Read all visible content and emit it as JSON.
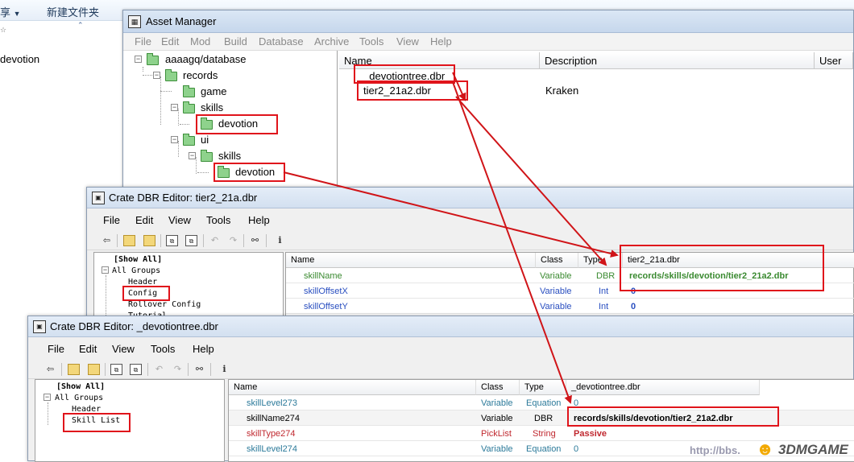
{
  "explorer": {
    "share_label": "享",
    "share_arrow": "▼",
    "new_folder_label": "新建文件夹",
    "nav_marker": "☆",
    "folder_item": "devotion"
  },
  "asset_manager": {
    "title": "Asset Manager",
    "menu": [
      "File",
      "Edit",
      "Mod",
      "Build",
      "Database",
      "Archive",
      "Tools",
      "View",
      "Help"
    ],
    "tree": {
      "root": "aaaagq/database",
      "records": "records",
      "game": "game",
      "skills": "skills",
      "devotion": "devotion",
      "ui": "ui",
      "ui_skills": "skills",
      "ui_devotion": "devotion"
    },
    "columns": {
      "name": "Name",
      "description": "Description",
      "user": "User"
    },
    "files": [
      {
        "name": "_devotiontree.dbr",
        "description": ""
      },
      {
        "name": "tier2_21a2.dbr",
        "description": "Kraken"
      }
    ]
  },
  "editor1": {
    "title": "Crate DBR Editor: tier2_21a.dbr",
    "menu": [
      "File",
      "Edit",
      "View",
      "Tools",
      "Help"
    ],
    "groups": [
      "[Show All]",
      "All Groups",
      "Header",
      "Config",
      "Rollover Config",
      "Tutorial"
    ],
    "columns": {
      "name": "Name",
      "class": "Class",
      "type": "Type",
      "value": "tier2_21a.dbr"
    },
    "rows": [
      {
        "name": "skillName",
        "class": "Variable",
        "type": "DBR",
        "value": "records/skills/devotion/tier2_21a2.dbr"
      },
      {
        "name": "skillOffsetX",
        "class": "Variable",
        "type": "Int",
        "value": "0"
      },
      {
        "name": "skillOffsetY",
        "class": "Variable",
        "type": "Int",
        "value": "0"
      }
    ]
  },
  "editor2": {
    "title": "Crate DBR Editor: _devotiontree.dbr",
    "menu": [
      "File",
      "Edit",
      "View",
      "Tools",
      "Help"
    ],
    "groups": [
      "[Show All]",
      "All Groups",
      "Header",
      "Skill List"
    ],
    "columns": {
      "name": "Name",
      "class": "Class",
      "type": "Type",
      "value": "_devotiontree.dbr"
    },
    "rows": [
      {
        "name": "skillLevel273",
        "class": "Variable",
        "type": "Equation",
        "value": "0"
      },
      {
        "name": "skillName274",
        "class": "Variable",
        "type": "DBR",
        "value": "records/skills/devotion/tier2_21a2.dbr"
      },
      {
        "name": "skillType274",
        "class": "PickList",
        "type": "String",
        "value": "Passive"
      },
      {
        "name": "skillLevel274",
        "class": "Variable",
        "type": "Equation",
        "value": "0"
      }
    ]
  },
  "watermark": {
    "url": "http://bbs.",
    "logo": "3DMGAME"
  },
  "colors": {
    "highlight": "#e0141b",
    "arrow": "#d01418",
    "folder": "#8ed28c"
  }
}
